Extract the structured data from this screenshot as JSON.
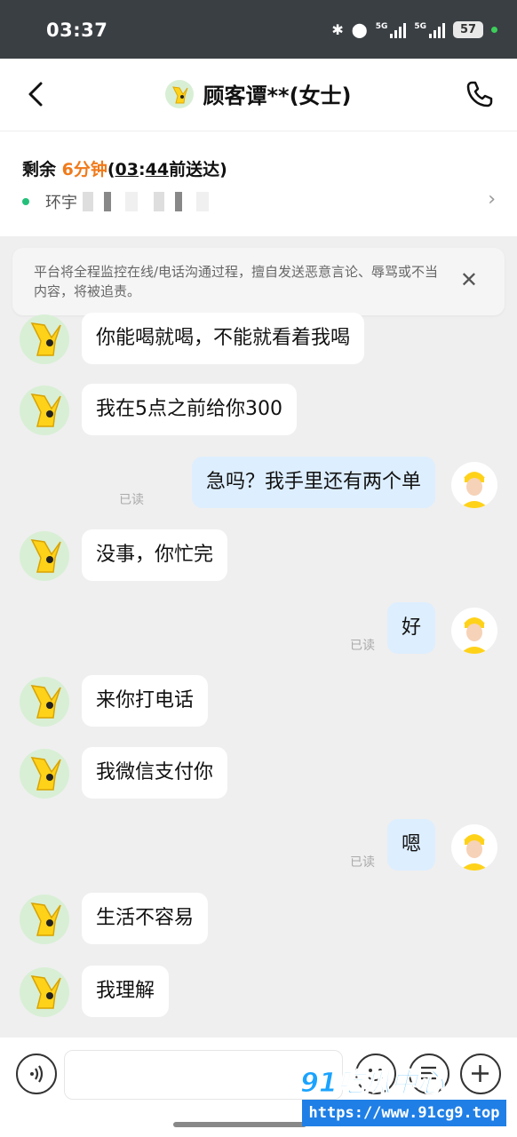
{
  "status_bar": {
    "time": "03:37",
    "signal1": "5G",
    "signal2": "5G",
    "battery": "57"
  },
  "header": {
    "title": "顾客谭**(女士)"
  },
  "order": {
    "remain_prefix": "剩余 ",
    "remain_minutes": "6分钟",
    "open_paren": "(",
    "eta_hour": "03",
    "eta_colon": ":",
    "eta_min": "44",
    "eta_suffix": "前送达)",
    "address": "环宇"
  },
  "notice": {
    "text": "平台将全程监控在线/电话沟通过程，擅自发送恶意言论、辱骂或不当内容，将被追责。"
  },
  "read_label": "已读",
  "messages": [
    {
      "side": "in",
      "text": "你能喝就喝，不能就看着我喝"
    },
    {
      "side": "in",
      "text": "我在5点之前给你300"
    },
    {
      "side": "out",
      "text": "急吗？我手里还有两个单",
      "read": "已读"
    },
    {
      "side": "in",
      "text": "没事，你忙完"
    },
    {
      "side": "out",
      "text": "好",
      "read": "已读"
    },
    {
      "side": "in",
      "text": "来你打电话"
    },
    {
      "side": "in",
      "text": "我微信支付你"
    },
    {
      "side": "out",
      "text": "嗯",
      "read": "已读"
    },
    {
      "side": "in",
      "text": "生活不容易"
    },
    {
      "side": "in",
      "text": "我理解"
    }
  ],
  "input": {
    "placeholder": ""
  },
  "watermark": {
    "logo": "91吃瓜中心",
    "url": "https://www.91cg9.top"
  },
  "colors": {
    "accent_orange": "#f07a1a",
    "bubble_out": "#ddeefe",
    "status_bg": "#3a3f44",
    "green_dot": "#24c07a"
  },
  "icons": [
    "back-icon",
    "phone-icon",
    "close-icon",
    "chevron-right-icon",
    "voice-icon",
    "emoji-icon",
    "quick-reply-icon",
    "plus-icon"
  ]
}
